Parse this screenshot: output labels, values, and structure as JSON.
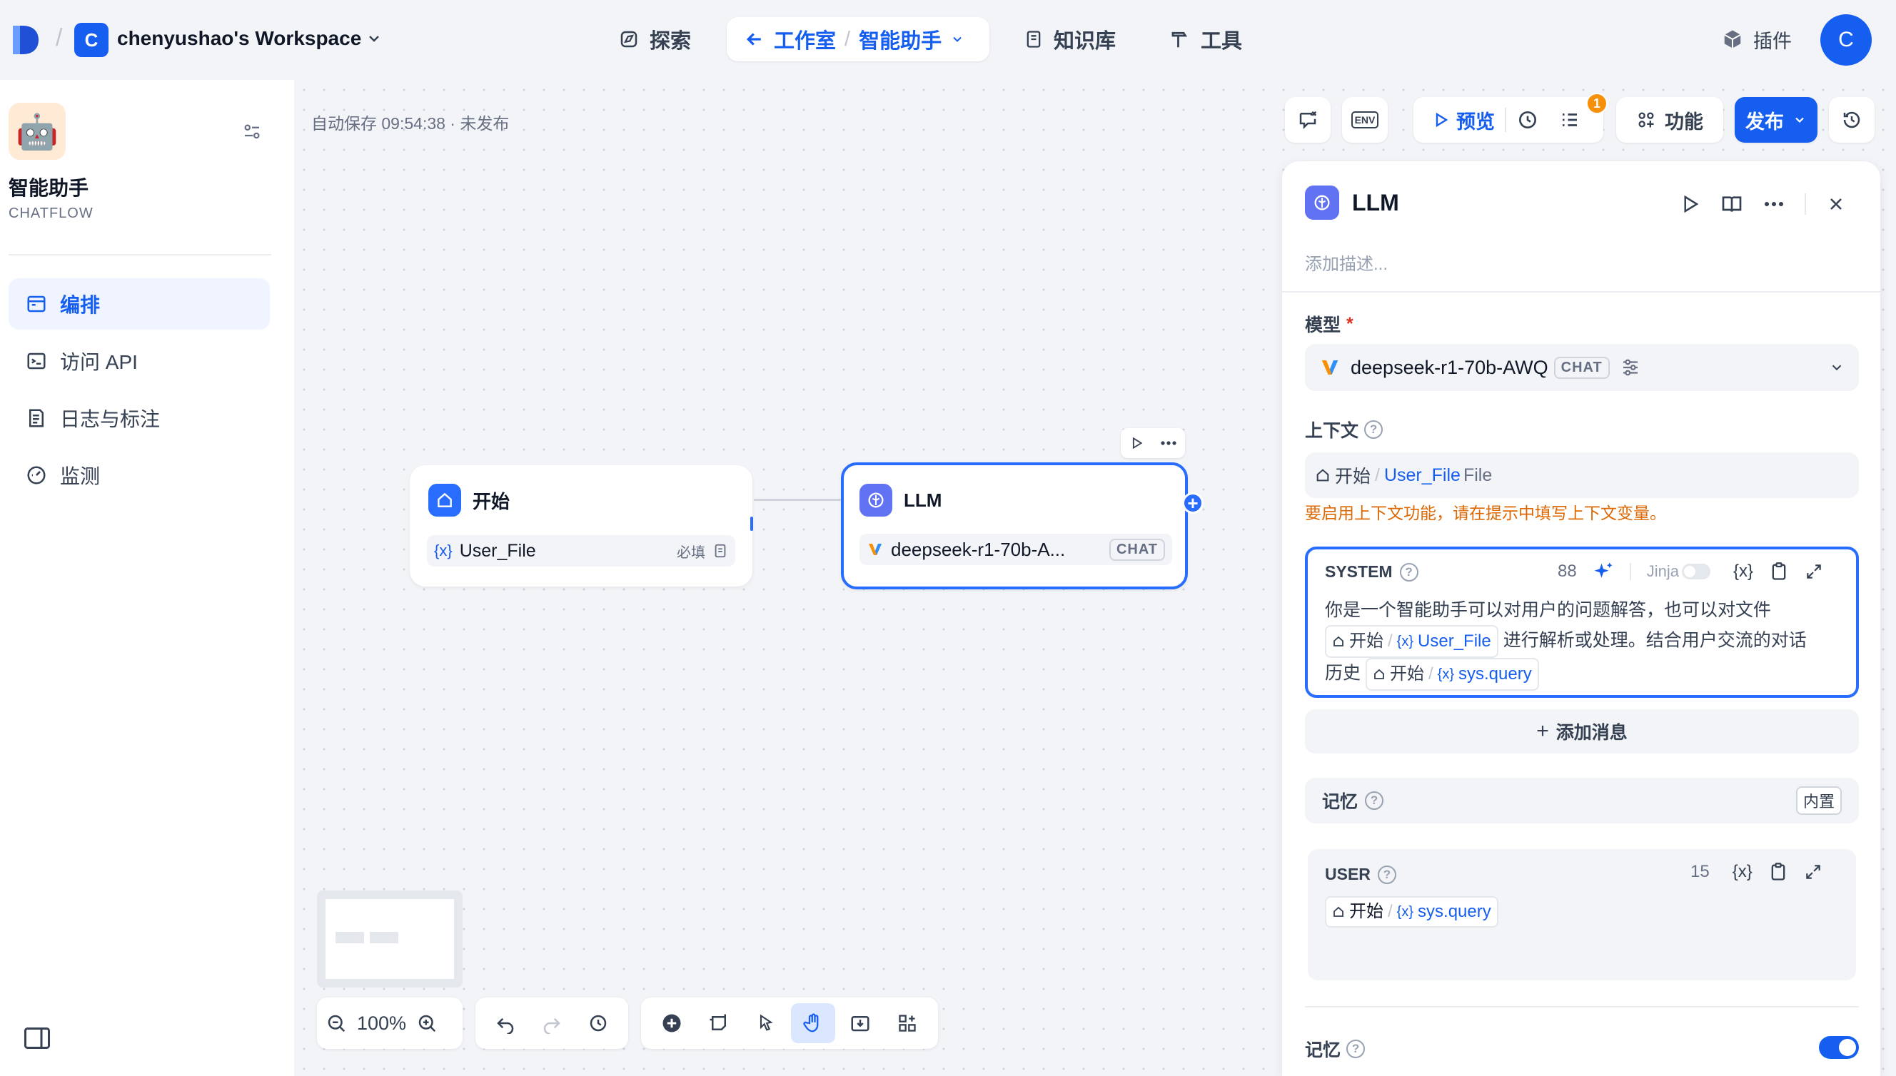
{
  "header": {
    "workspace_initial": "C",
    "workspace_name": "chenyushao's Workspace",
    "nav": {
      "explore": "探索",
      "studio": "工作室",
      "app": "智能助手",
      "knowledge": "知识库",
      "tools": "工具",
      "plugins": "插件"
    },
    "user_initial": "C"
  },
  "sidebar": {
    "app_icon": "🤖",
    "app_name": "智能助手",
    "app_type": "CHATFLOW",
    "items": [
      {
        "label": "编排",
        "icon": "layout-icon"
      },
      {
        "label": "访问 API",
        "icon": "terminal-icon"
      },
      {
        "label": "日志与标注",
        "icon": "file-list-icon"
      },
      {
        "label": "监测",
        "icon": "gauge-icon"
      }
    ]
  },
  "canvas": {
    "autosave": "自动保存 09:54:38 · 未发布",
    "start_node": {
      "title": "开始",
      "var_name": "User_File",
      "required": "必填"
    },
    "llm_node": {
      "title": "LLM",
      "model": "deepseek-r1-70b-A...",
      "mode": "CHAT"
    },
    "zoom": "100%"
  },
  "toolbar": {
    "env": "ENV",
    "preview": "预览",
    "badge": "1",
    "features": "功能",
    "publish": "发布"
  },
  "panel": {
    "title": "LLM",
    "desc_placeholder": "添加描述...",
    "model_label": "模型",
    "required_mark": "*",
    "model_name": "deepseek-r1-70b-AWQ",
    "model_mode": "CHAT",
    "context_label": "上下文",
    "context_node": "开始",
    "context_var": "User_File",
    "context_type": "File",
    "context_warning": "要启用上下文功能，请在提示中填写上下文变量。",
    "system": {
      "label": "SYSTEM",
      "count": "88",
      "jinja": "Jinja",
      "text1": "你是一个智能助手可以对用户的问题解答，也可以对文件",
      "node": "开始",
      "var1": "User_File",
      "text2": "进行解析或处理。结合用户交流的对话",
      "text3": "历史",
      "var2": "sys.query"
    },
    "add_message": "添加消息",
    "memory_label": "记忆",
    "memory_tag": "内置",
    "user": {
      "label": "USER",
      "count": "15",
      "node": "开始",
      "var": "sys.query"
    },
    "memory_label2": "记忆"
  },
  "colors": {
    "accent": "#155eef",
    "warning": "#dc6803",
    "badge": "#f79009"
  }
}
